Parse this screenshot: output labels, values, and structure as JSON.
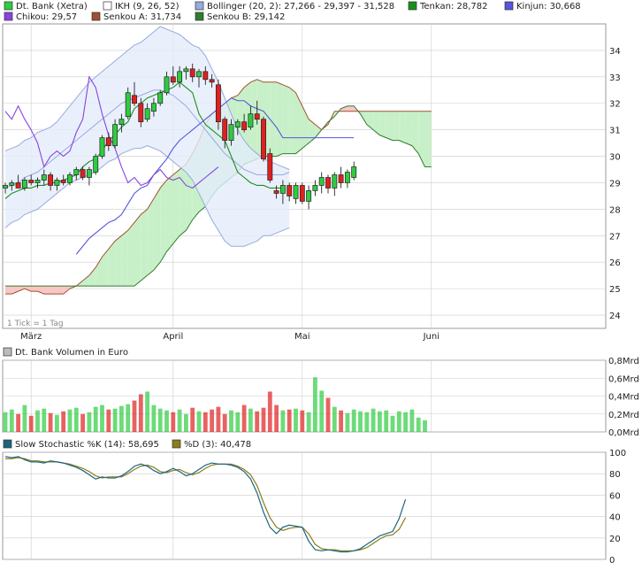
{
  "colors": {
    "up": "#2ecc40",
    "down": "#e02020",
    "tenkan": "#1a8f1a",
    "kinjun": "#5555dd",
    "chikou": "#8844dd",
    "bollinger_line": "#99aadd",
    "bollinger_fill": "#e4ecfb",
    "cloud_bull": "#c8f0c8",
    "cloud_bear": "#f7c6c6",
    "senkou_a_line": "#a0522d",
    "senkou_b_line": "#2e7d2e",
    "stoch_k": "#1a6680",
    "stoch_d": "#8b7d1c",
    "grid": "#cccccc",
    "frame": "#999999"
  },
  "main_chart": {
    "legend": [
      {
        "label": "Dt. Bank (Xetra)",
        "color": "#2ecc40"
      },
      {
        "label": "IKH (9, 26, 52)",
        "color": "#ffffff"
      },
      {
        "label": "Bollinger (20, 2): 27,266 - 29,397 - 31,528",
        "color": "#99aadd"
      },
      {
        "label": "Tenkan: 28,782",
        "color": "#1a8f1a"
      },
      {
        "label": "Kinjun: 30,668",
        "color": "#5555dd"
      },
      {
        "label": "Chikou: 29,57",
        "color": "#8844dd"
      },
      {
        "label": "Senkou A: 31,734",
        "color": "#a0522d"
      },
      {
        "label": "Senkou B: 29,142",
        "color": "#2e7d2e"
      }
    ],
    "footnote": "1 Tick = 1 Tag",
    "x_labels": [
      {
        "label": "März",
        "day": 4
      },
      {
        "label": "April",
        "day": 26
      },
      {
        "label": "Mai",
        "day": 46
      },
      {
        "label": "Juni",
        "day": 66
      }
    ],
    "y_ticks": [
      24,
      25,
      26,
      27,
      28,
      29,
      30,
      31,
      32,
      33,
      34
    ],
    "ylim": [
      23.5,
      35
    ]
  },
  "chart_data": [
    {
      "type": "candlestick",
      "title": "Dt. Bank (Xetra)",
      "ylim": [
        23.5,
        35
      ],
      "y_ticks": [
        24,
        25,
        26,
        27,
        28,
        29,
        30,
        31,
        32,
        33,
        34
      ],
      "x_tick_labels": [
        "März",
        "April",
        "Mai",
        "Juni"
      ],
      "ohlc": [
        [
          28.8,
          29.0,
          28.6,
          28.9
        ],
        [
          28.9,
          29.1,
          28.7,
          29.0
        ],
        [
          29.0,
          29.3,
          28.8,
          28.8
        ],
        [
          28.8,
          29.2,
          28.7,
          29.1
        ],
        [
          29.1,
          29.3,
          28.9,
          29.0
        ],
        [
          29.0,
          29.2,
          28.8,
          29.1
        ],
        [
          29.1,
          29.5,
          28.9,
          29.3
        ],
        [
          29.3,
          29.4,
          28.7,
          28.9
        ],
        [
          28.9,
          29.2,
          28.7,
          29.1
        ],
        [
          29.1,
          29.3,
          28.9,
          29.0
        ],
        [
          29.0,
          29.4,
          28.9,
          29.3
        ],
        [
          29.3,
          29.6,
          29.1,
          29.5
        ],
        [
          29.5,
          29.6,
          29.1,
          29.2
        ],
        [
          29.2,
          29.6,
          28.9,
          29.5
        ],
        [
          29.4,
          30.1,
          29.3,
          30.0
        ],
        [
          30.0,
          30.8,
          29.9,
          30.7
        ],
        [
          30.7,
          30.9,
          30.2,
          30.4
        ],
        [
          30.4,
          31.4,
          30.3,
          31.2
        ],
        [
          31.2,
          31.6,
          30.9,
          31.4
        ],
        [
          31.5,
          32.6,
          31.4,
          32.4
        ],
        [
          32.3,
          32.8,
          31.9,
          32.0
        ],
        [
          32.0,
          32.2,
          31.1,
          31.3
        ],
        [
          31.4,
          32.0,
          31.3,
          31.8
        ],
        [
          31.7,
          32.2,
          31.5,
          32.0
        ],
        [
          32.0,
          32.5,
          31.9,
          32.4
        ],
        [
          32.4,
          33.2,
          32.3,
          33.0
        ],
        [
          33.0,
          33.4,
          32.7,
          32.8
        ],
        [
          32.8,
          33.4,
          32.6,
          33.2
        ],
        [
          33.2,
          33.4,
          32.9,
          33.3
        ],
        [
          33.3,
          33.5,
          32.8,
          33.0
        ],
        [
          33.0,
          33.3,
          32.6,
          33.2
        ],
        [
          33.2,
          33.4,
          32.7,
          32.9
        ],
        [
          32.9,
          33.1,
          32.6,
          32.8
        ],
        [
          32.7,
          32.9,
          31.0,
          31.3
        ],
        [
          31.4,
          31.5,
          30.3,
          30.6
        ],
        [
          30.6,
          31.4,
          30.4,
          31.2
        ],
        [
          31.1,
          31.4,
          30.8,
          31.3
        ],
        [
          31.3,
          31.6,
          30.9,
          31.0
        ],
        [
          31.1,
          31.9,
          31.0,
          31.6
        ],
        [
          31.6,
          32.1,
          31.2,
          31.4
        ],
        [
          31.4,
          31.5,
          29.8,
          29.9
        ],
        [
          30.1,
          30.3,
          29.0,
          29.1
        ],
        [
          28.7,
          28.9,
          28.4,
          28.6
        ],
        [
          28.6,
          29.1,
          28.2,
          28.9
        ],
        [
          28.9,
          29.0,
          28.3,
          28.5
        ],
        [
          28.4,
          29.0,
          28.2,
          28.9
        ],
        [
          28.9,
          29.0,
          28.2,
          28.3
        ],
        [
          28.3,
          28.9,
          28.0,
          28.7
        ],
        [
          28.7,
          29.1,
          28.5,
          28.9
        ],
        [
          28.9,
          29.4,
          28.6,
          29.2
        ],
        [
          29.2,
          29.3,
          28.6,
          28.8
        ],
        [
          28.8,
          29.4,
          28.5,
          29.3
        ],
        [
          29.3,
          29.6,
          28.8,
          29.0
        ],
        [
          29.0,
          29.5,
          28.8,
          29.4
        ],
        [
          29.2,
          29.8,
          29.1,
          29.6
        ]
      ]
    },
    {
      "type": "bar",
      "title": "Dt. Bank Volumen in Euro",
      "ylim": [
        0,
        0.8
      ],
      "y_tick_labels": [
        "0,8Mrd",
        "0,6Mrd",
        "0,4Mrd",
        "0,2Mrd",
        "0,0Mrd"
      ],
      "values": [
        0.22,
        0.25,
        0.2,
        0.3,
        0.18,
        0.24,
        0.26,
        0.21,
        0.19,
        0.23,
        0.25,
        0.27,
        0.2,
        0.22,
        0.28,
        0.3,
        0.25,
        0.26,
        0.29,
        0.31,
        0.35,
        0.42,
        0.45,
        0.3,
        0.26,
        0.24,
        0.22,
        0.25,
        0.2,
        0.27,
        0.23,
        0.22,
        0.25,
        0.28,
        0.2,
        0.24,
        0.22,
        0.3,
        0.26,
        0.23,
        0.27,
        0.45,
        0.3,
        0.24,
        0.25,
        0.26,
        0.24,
        0.22,
        0.61,
        0.46,
        0.38,
        0.28,
        0.24,
        0.21,
        0.25,
        0.23,
        0.22,
        0.26,
        0.23,
        0.24,
        0.18,
        0.23,
        0.22,
        0.25,
        0.16,
        0.13
      ]
    },
    {
      "type": "line",
      "title": "Slow Stochastic",
      "ylim": [
        0,
        100
      ],
      "y_ticks": [
        0,
        20,
        40,
        60,
        80,
        100
      ],
      "series": [
        {
          "name": "Slow Stochastic %K (14): 58,695",
          "color": "#1a6680",
          "values": [
            96,
            95,
            96,
            93,
            91,
            91,
            90,
            92,
            91,
            90,
            88,
            86,
            83,
            79,
            75,
            77,
            76,
            76,
            78,
            82,
            87,
            89,
            87,
            83,
            80,
            82,
            85,
            82,
            78,
            80,
            84,
            88,
            90,
            89,
            89,
            88,
            86,
            82,
            75,
            62,
            44,
            30,
            24,
            30,
            32,
            31,
            30,
            17,
            9,
            8,
            9,
            8,
            7,
            7,
            8,
            10,
            14,
            18,
            22,
            24,
            26,
            38,
            56
          ]
        },
        {
          "name": "%D (3): 40,478",
          "color": "#8b7d1c",
          "values": [
            94,
            94,
            95,
            94,
            92,
            92,
            91,
            91,
            91,
            90,
            89,
            87,
            85,
            82,
            78,
            76,
            77,
            77,
            77,
            80,
            84,
            87,
            88,
            86,
            82,
            81,
            83,
            84,
            81,
            79,
            81,
            85,
            88,
            89,
            89,
            89,
            87,
            84,
            79,
            69,
            53,
            39,
            30,
            27,
            29,
            30,
            30,
            24,
            14,
            10,
            9,
            9,
            8,
            8,
            8,
            9,
            11,
            15,
            19,
            22,
            23,
            28,
            39
          ]
        }
      ]
    }
  ],
  "ichimoku": {
    "tenkan": [
      28.4,
      28.6,
      28.7,
      28.8,
      28.8,
      28.9,
      28.9,
      29.0,
      29.0,
      29.1,
      29.2,
      29.3,
      29.6,
      29.8,
      29.9,
      30.2,
      30.6,
      30.8,
      31.1,
      31.3,
      31.8,
      32.0,
      32.2,
      32.3,
      32.4,
      32.5,
      32.6,
      32.8,
      32.6,
      32.4,
      31.6,
      31.2,
      31.0,
      30.8,
      30.6,
      30.0,
      29.4,
      29.2,
      29.0,
      28.9,
      28.9,
      28.8,
      28.8,
      28.8
    ],
    "kinjun": [
      26.3,
      26.6,
      26.9,
      27.1,
      27.3,
      27.5,
      27.6,
      27.8,
      28.2,
      28.6,
      28.8,
      28.9,
      29.3,
      29.6,
      29.9,
      30.3,
      30.6,
      30.8,
      31.0,
      31.2,
      31.4,
      31.6,
      31.8,
      32.0,
      32.2,
      32.1,
      32.1,
      31.9,
      31.8,
      31.7,
      31.4,
      31.1,
      30.7,
      30.7,
      30.7,
      30.7,
      30.7,
      30.7,
      30.7,
      30.7,
      30.7,
      30.7,
      30.7,
      30.7
    ],
    "kinjun_start": 11,
    "chikou": [
      31.7,
      31.4,
      31.9,
      31.4,
      31.0,
      30.5,
      29.6,
      30.0,
      30.2,
      30.0,
      30.2,
      30.9,
      31.4,
      33.0,
      32.6,
      31.6,
      30.8,
      30.3,
      29.6,
      29.0,
      29.2,
      28.9,
      29.0,
      29.3,
      29.5,
      29.2,
      29.1,
      29.2,
      28.9,
      28.8,
      29.0,
      29.2,
      29.4,
      29.6
    ],
    "senkou_a": [
      24.8,
      24.8,
      24.9,
      25.0,
      24.9,
      24.9,
      24.8,
      24.8,
      24.8,
      24.8,
      25.0,
      25.1,
      25.3,
      25.5,
      25.8,
      26.2,
      26.5,
      26.8,
      27.0,
      27.2,
      27.5,
      27.8,
      28.0,
      28.4,
      28.8,
      29.1,
      29.3,
      29.5,
      29.7,
      30.1,
      30.6,
      31.2,
      31.6,
      31.8,
      32.0,
      32.2,
      32.3,
      32.6,
      32.8,
      32.9,
      32.8,
      32.8,
      32.8,
      32.7,
      32.6,
      32.4,
      31.9,
      31.4,
      31.2,
      31.0,
      31.2,
      31.7,
      31.7,
      31.7,
      31.7,
      31.7,
      31.7,
      31.7,
      31.7,
      31.7,
      31.7,
      31.7,
      31.7,
      31.7,
      31.7,
      31.7,
      31.7
    ],
    "senkou_b": [
      25.1,
      25.1,
      25.1,
      25.1,
      25.1,
      25.1,
      25.1,
      25.1,
      25.1,
      25.1,
      25.1,
      25.1,
      25.1,
      25.1,
      25.1,
      25.1,
      25.1,
      25.1,
      25.1,
      25.1,
      25.1,
      25.3,
      25.5,
      25.7,
      26.0,
      26.4,
      26.7,
      27.0,
      27.2,
      27.6,
      27.9,
      28.1,
      28.5,
      28.8,
      29.0,
      29.2,
      29.4,
      29.7,
      29.8,
      29.9,
      30.0,
      30.0,
      30.0,
      30.1,
      30.1,
      30.1,
      30.3,
      30.5,
      30.7,
      31.0,
      31.3,
      31.5,
      31.8,
      31.9,
      31.9,
      31.6,
      31.2,
      31.0,
      30.8,
      30.7,
      30.6,
      30.6,
      30.5,
      30.4,
      30.1,
      29.6,
      29.6
    ],
    "senkou_start": 0
  },
  "bollinger": {
    "upper": [
      30.2,
      30.3,
      30.4,
      30.6,
      30.7,
      30.9,
      31.0,
      31.1,
      31.3,
      31.6,
      31.9,
      32.2,
      32.5,
      32.8,
      33.0,
      33.2,
      33.4,
      33.6,
      33.8,
      34.0,
      34.2,
      34.3,
      34.5,
      34.7,
      34.9,
      34.8,
      34.7,
      34.6,
      34.4,
      34.2,
      34.1,
      33.8,
      33.3,
      32.8,
      32.2,
      31.6,
      31.0,
      30.6,
      30.3,
      30.1,
      29.9,
      29.8,
      29.7,
      29.6,
      29.5
    ],
    "middle": [
      28.8,
      28.9,
      29.0,
      29.2,
      29.3,
      29.4,
      29.6,
      29.8,
      30.0,
      30.2,
      30.4,
      30.6,
      30.8,
      31.0,
      31.2,
      31.4,
      31.6,
      31.8,
      32.0,
      32.1,
      32.2,
      32.3,
      32.4,
      32.5,
      32.5,
      32.4,
      32.3,
      32.1,
      31.9,
      31.6,
      31.3,
      31.0,
      30.7,
      30.4,
      30.1,
      29.9,
      29.7,
      29.5,
      29.4,
      29.3,
      29.3,
      29.3,
      29.3,
      29.3,
      29.4
    ],
    "lower": [
      27.3,
      27.5,
      27.6,
      27.8,
      27.9,
      28.0,
      28.2,
      28.4,
      28.6,
      28.8,
      29.0,
      29.1,
      29.2,
      29.3,
      29.4,
      29.6,
      29.8,
      29.9,
      30.1,
      30.2,
      30.3,
      30.3,
      30.4,
      30.3,
      30.2,
      30.0,
      29.8,
      29.6,
      29.4,
      29.1,
      28.6,
      28.1,
      27.6,
      27.2,
      26.8,
      26.6,
      26.6,
      26.6,
      26.7,
      26.8,
      27.0,
      27.0,
      27.1,
      27.2,
      27.3
    ],
    "start": 0,
    "pre_start": [
      26.9,
      27.5,
      28.1
    ]
  },
  "volume_panel": {
    "legend": "Dt. Bank Volumen in Euro",
    "y_labels": [
      "0,8Mrd",
      "0,6Mrd",
      "0,4Mrd",
      "0,2Mrd",
      "0,0Mrd"
    ]
  },
  "stoch_panel": {
    "legend_k": "Slow Stochastic %K (14): 58,695",
    "legend_d": "%D (3): 40,478",
    "y_labels": [
      "100",
      "80",
      "60",
      "40",
      "20",
      "0"
    ]
  }
}
